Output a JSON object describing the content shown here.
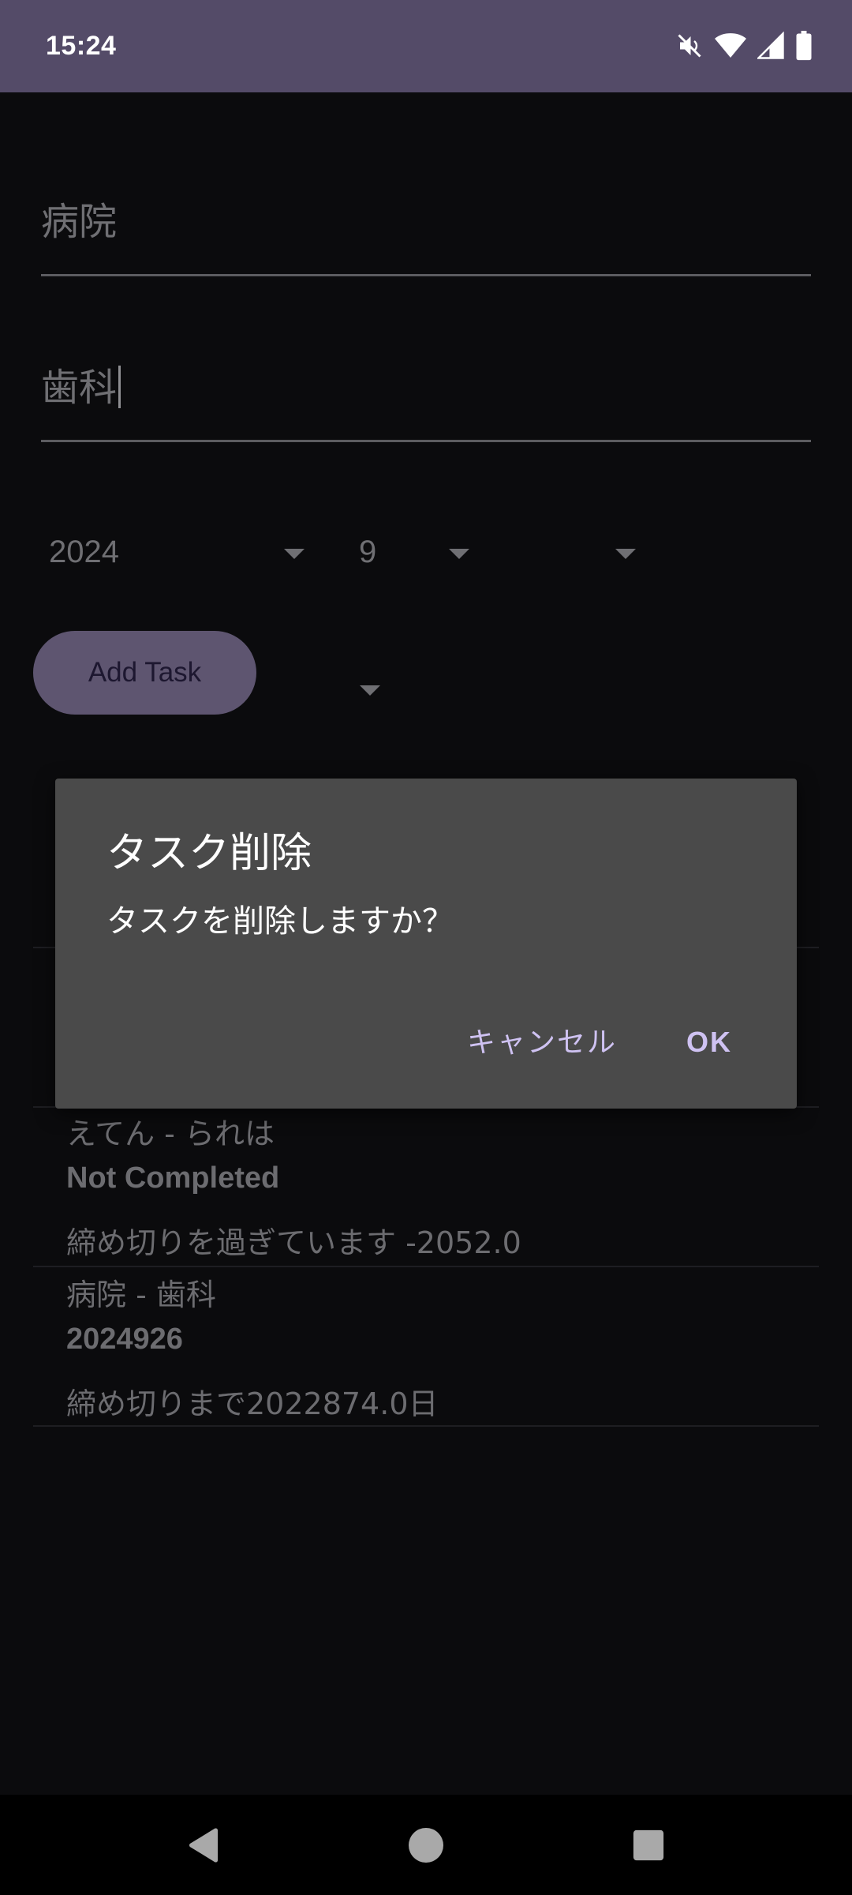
{
  "status_bar": {
    "time": "15:24",
    "icons": [
      "mute-icon",
      "wifi-icon",
      "signal-icon",
      "battery-icon"
    ]
  },
  "form": {
    "title_field_value": "病院",
    "detail_field_value": "歯科",
    "year_value": "2024",
    "month_value": "9",
    "day_value": "",
    "add_task_label": "Add Task"
  },
  "tasks": [
    {
      "title": "えてん - られは",
      "status": "Not Completed",
      "deadline": "締め切りを過ぎています  -2052.0"
    },
    {
      "title": "病院 - 歯科",
      "status": "2024926",
      "deadline": "締め切りまで2022874.0日"
    }
  ],
  "dialog": {
    "title": "タスク削除",
    "message": "タスクを削除しますか？",
    "cancel_label": "キャンセル",
    "ok_label": "OK"
  },
  "colors": {
    "status_bar_bg": "#544b68",
    "accent": "#cfc2f2",
    "button_bg": "#5e5570",
    "dialog_bg": "#4a4a4a"
  }
}
